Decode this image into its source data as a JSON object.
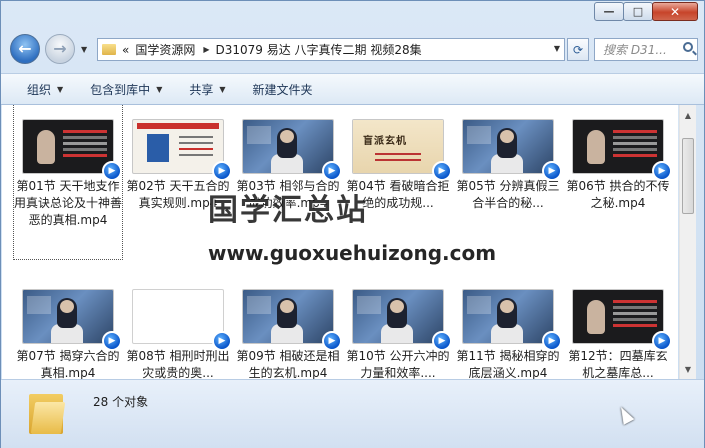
{
  "window": {
    "caption_buttons": [
      {
        "name": "minimize-button",
        "glyph": "—"
      },
      {
        "name": "maximize-button",
        "glyph": "□"
      },
      {
        "name": "close-button",
        "glyph": "✕"
      }
    ]
  },
  "nav": {
    "back_glyph": "←",
    "forward_glyph": "→",
    "dropdown_glyph": "▼"
  },
  "address": {
    "chevrons": "«",
    "crumbs": [
      "国学资源网",
      "D31079 易达 八字真传二期 视频28集"
    ],
    "separator": "▶",
    "dropdown_glyph": "▼",
    "refresh_glyph": "⟳"
  },
  "search": {
    "placeholder": "搜索 D31..."
  },
  "toolbar": {
    "items": [
      {
        "label": "组织",
        "has_dropdown": true
      },
      {
        "label": "包含到库中",
        "has_dropdown": true
      },
      {
        "label": "共享",
        "has_dropdown": true
      },
      {
        "label": "新建文件夹",
        "has_dropdown": false
      }
    ],
    "dropdown_glyph": "▼"
  },
  "files": [
    {
      "label": "第01节 天干地支作用真诀总论及十神善恶的真相.mp4",
      "thumb": "dark",
      "selected": true
    },
    {
      "label": "第02节 天干五合的真实规则.mp4",
      "thumb": "cert",
      "selected": false
    },
    {
      "label": "第03节 相邻与合的成功效率.mp4",
      "thumb": "blue",
      "selected": false
    },
    {
      "label": "第04节 看破暗合拒绝的成功规...",
      "thumb": "paper",
      "selected": false
    },
    {
      "label": "第05节 分辨真假三合半合的秘...",
      "thumb": "blue",
      "selected": false
    },
    {
      "label": "第06节 拱合的不传之秘.mp4",
      "thumb": "dark",
      "selected": false
    },
    {
      "label": "第07节 揭穿六合的真相.mp4",
      "thumb": "blue",
      "selected": false
    },
    {
      "label": "第08节 相刑时刑出灾或贵的奥...",
      "thumb": "white",
      "selected": false
    },
    {
      "label": "第09节 相破还是相生的玄机.mp4",
      "thumb": "blue",
      "selected": false
    },
    {
      "label": "第10节 公开六冲的力量和效率....",
      "thumb": "blue",
      "selected": false
    },
    {
      "label": "第11节 揭秘相穿的底层涵义.mp4",
      "thumb": "blue",
      "selected": false
    },
    {
      "label": "第12节：四墓库玄机之墓库总...",
      "thumb": "dark",
      "selected": false
    }
  ],
  "paper_thumb_title": "盲派玄机",
  "badge_glyph": "▶",
  "watermark": {
    "title": "国学汇总站",
    "url": "www.guoxuehuizong.com"
  },
  "scrollbar": {
    "up_glyph": "▲",
    "down_glyph": "▼"
  },
  "status": {
    "count_text": "28 个对象"
  }
}
